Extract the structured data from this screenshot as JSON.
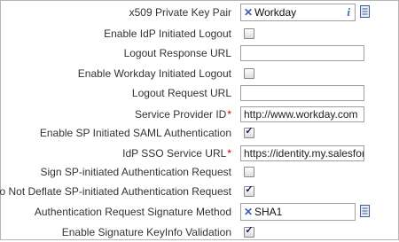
{
  "x509": {
    "label": "x509 Private Key Pair",
    "value": "Workday"
  },
  "enable_idp_logout": {
    "label": "Enable IdP Initiated Logout",
    "checked": false
  },
  "logout_response_url": {
    "label": "Logout Response URL",
    "value": ""
  },
  "enable_workday_logout": {
    "label": "Enable Workday Initiated Logout",
    "checked": false
  },
  "logout_request_url": {
    "label": "Logout Request URL",
    "value": ""
  },
  "service_provider_id": {
    "label": "Service Provider ID",
    "required": "*",
    "value": "http://www.workday.com"
  },
  "enable_sp_saml": {
    "label": "Enable SP Initiated SAML Authentication",
    "checked": true
  },
  "idp_sso_url": {
    "label": "IdP SSO Service URL",
    "required": "*",
    "value": "https://identity.my.salesforce"
  },
  "sign_sp_request": {
    "label": "Sign SP-initiated Authentication Request",
    "checked": false
  },
  "no_deflate": {
    "label": "Do Not Deflate SP-initiated Authentication Request",
    "checked": true
  },
  "sig_method": {
    "label": "Authentication Request Signature Method",
    "value": "SHA1"
  },
  "keyinfo": {
    "label": "Enable Signature KeyInfo Validation",
    "checked": true
  },
  "glyphs": {
    "remove": "✕",
    "info": "i",
    "check": "✓"
  },
  "colors": {
    "required": "#cc0000",
    "remove_x": "#3a5fae",
    "info": "#3f64c8"
  }
}
